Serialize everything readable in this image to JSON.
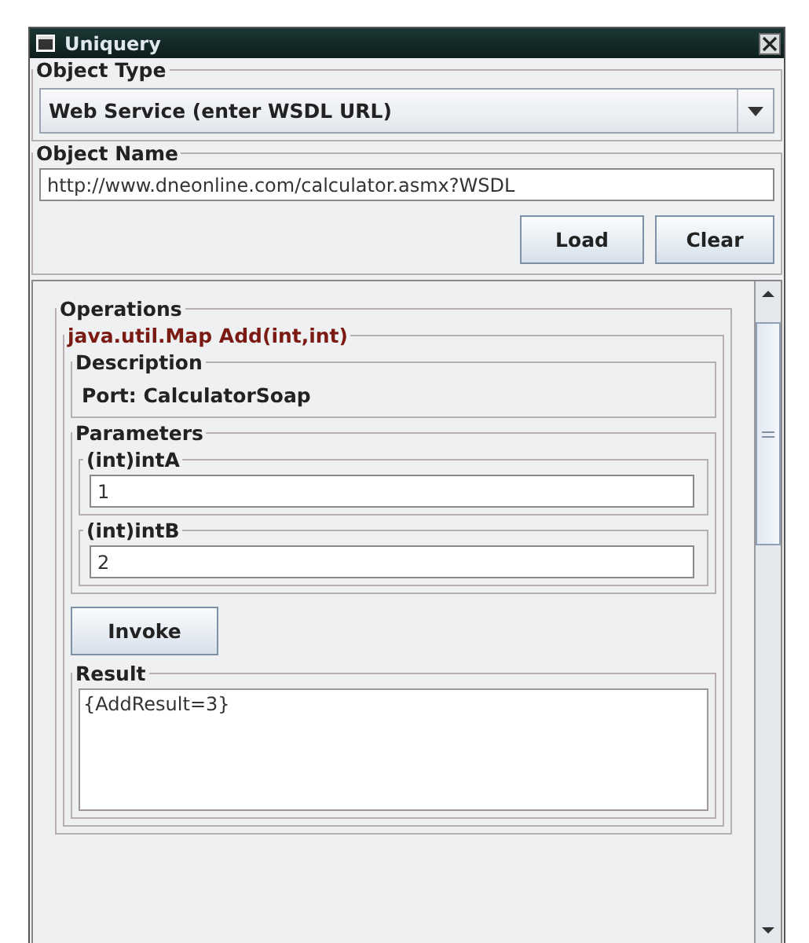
{
  "window": {
    "title": "Uniquery"
  },
  "object_type": {
    "label": "Object Type",
    "value": "Web Service (enter WSDL URL)"
  },
  "object_name": {
    "label": "Object Name",
    "value": "http://www.dneonline.com/calculator.asmx?WSDL"
  },
  "buttons": [
    "Load",
    "Clear"
  ],
  "operations": {
    "label": "Operations",
    "operation": {
      "signature": "java.util.Map Add(int,int)",
      "description_label": "Description",
      "description": "Port: CalculatorSoap",
      "parameters_label": "Parameters",
      "parameters": [
        {
          "label": "(int)intA",
          "value": "1"
        },
        {
          "label": "(int)intB",
          "value": "2"
        }
      ],
      "invoke": "Invoke",
      "result_label": "Result",
      "result": "{AddResult=3}"
    }
  }
}
